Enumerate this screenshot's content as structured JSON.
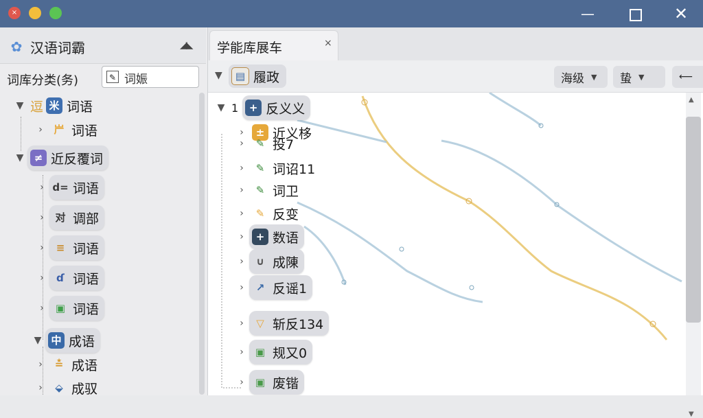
{
  "window": {
    "close_glyph": "×",
    "minimize_glyph": "—",
    "close_button_glyph": "✕"
  },
  "sidebar": {
    "app_title": "汉语词霸",
    "filter_label": "词库分类(务)",
    "filter_value": "词娠",
    "tree": [
      {
        "label": "词语",
        "prefix": "逗",
        "icon": "米",
        "icon_color": "#3f6fb0",
        "expanded": true
      },
      {
        "label": "词语",
        "prefix": "",
        "icon": "屵",
        "icon_color": "#e6a83a",
        "expanded": false
      },
      {
        "label": "近反覆词",
        "icon": "≠",
        "icon_color": "#7a6ec4",
        "expanded": true
      },
      {
        "label": "词语",
        "icon": "d=",
        "icon_color": "#3a3a3a",
        "expanded": false
      },
      {
        "label": "调部",
        "icon": "对",
        "icon_color": "#3a3a3a",
        "expanded": false
      },
      {
        "label": "词语",
        "icon": "≡",
        "icon_color": "#c88a2a",
        "expanded": false
      },
      {
        "label": "词语",
        "icon": "ɗ",
        "icon_color": "#3a5ea8",
        "expanded": false
      },
      {
        "label": "词语",
        "icon": "▣",
        "icon_color": "#3fa04a",
        "expanded": false
      },
      {
        "label": "成语",
        "icon": "中",
        "icon_color": "#3a6aa8",
        "expanded": true
      },
      {
        "label": "成语",
        "icon": "≛",
        "icon_color": "#d89a2e",
        "expanded": false
      },
      {
        "label": "成驭",
        "icon": "⬙",
        "icon_color": "#3a6aa8",
        "expanded": false
      }
    ]
  },
  "tab": {
    "label": "学能库展车",
    "close": "×"
  },
  "toolbar": {
    "node_label": "履政",
    "dropdown1": "海级",
    "dropdown2": "蛰",
    "dropdown3": "⟵"
  },
  "main_tree": {
    "root_number": "1",
    "root_label": "反义义",
    "items": [
      {
        "label": "近义栘",
        "icon_color": "#e6a83a"
      },
      {
        "label": "投7",
        "icon_color": "#3a8a3a"
      },
      {
        "label": "词诏11",
        "icon_color": "#3a8a3a"
      },
      {
        "label": "词卫",
        "icon_color": "#3a8a3a"
      },
      {
        "label": "反变",
        "icon_color": "#e6a83a"
      },
      {
        "label": "数语",
        "icon_color": "#34495e"
      },
      {
        "label": "成陳",
        "icon_color": "#555555"
      },
      {
        "label": "反谣1",
        "icon_color": "#3a6aa8"
      },
      {
        "label": "斩反134",
        "icon_color": "#e6a83a"
      },
      {
        "label": "规又0",
        "icon_color": "#4a9a4a"
      },
      {
        "label": "废锴",
        "icon_color": "#4a9a4a"
      }
    ]
  },
  "colors": {
    "titlebar": "#4e6a93",
    "accent_yellow": "#e8c46a",
    "accent_blue": "#a7c6d8"
  }
}
